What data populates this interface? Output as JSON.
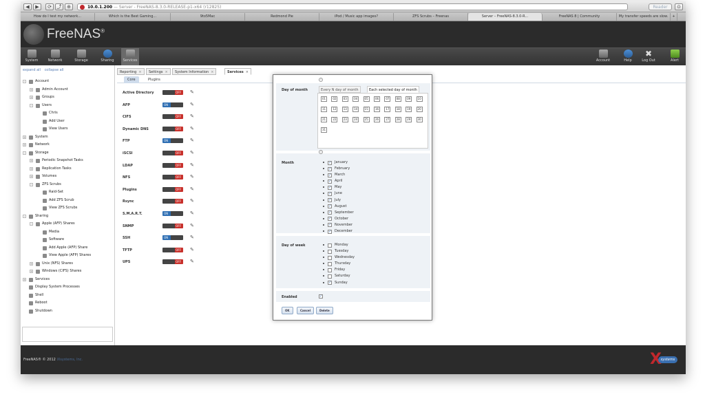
{
  "browser": {
    "nav_buttons": [
      "◀",
      "▶",
      "⟳",
      "⤴",
      "⊕"
    ],
    "address_host": "10.0.1.200",
    "address_rest": "— Server - FreeNAS-8.3.0-RELEASE-p1-x64 (r12825)",
    "reader_label": "Reader",
    "tabs": [
      "How do I test my network...",
      "Which is the Best Gaming...",
      "9to5Mac",
      "Redmond Pie",
      "iPod / Music app images?",
      "ZFS Scrubs – Freenas",
      "Server – FreeNAS-8.3.0-R...",
      "FreeNAS 8 | Community",
      "My transfer speeds are slow.",
      "+"
    ]
  },
  "header": {
    "logo_text": "FreeNAS",
    "logo_mark": "®"
  },
  "nav": {
    "left": [
      {
        "label": "System",
        "icon": "system-icon"
      },
      {
        "label": "Network",
        "icon": "network-icon"
      },
      {
        "label": "Storage",
        "icon": "storage-icon"
      },
      {
        "label": "Sharing",
        "icon": "sharing-icon"
      },
      {
        "label": "Services",
        "icon": "services-icon"
      }
    ],
    "right": [
      {
        "label": "Account",
        "icon": "account-icon"
      },
      {
        "label": "Help",
        "icon": "help-icon"
      },
      {
        "label": "Log Out",
        "icon": "logout-icon"
      },
      {
        "label": "Alert",
        "icon": "alert-icon"
      }
    ]
  },
  "tree": {
    "expand_all": "expand all",
    "collapse_all": "collapse all",
    "items": [
      {
        "label": "Account",
        "level": 0,
        "exp": "-"
      },
      {
        "label": "Admin Account",
        "level": 1,
        "exp": "+"
      },
      {
        "label": "Groups",
        "level": 1,
        "exp": "+"
      },
      {
        "label": "Users",
        "level": 1,
        "exp": "-"
      },
      {
        "label": "Chris",
        "level": 2,
        "exp": ""
      },
      {
        "label": "Add User",
        "level": 2,
        "exp": ""
      },
      {
        "label": "View Users",
        "level": 2,
        "exp": ""
      },
      {
        "label": "System",
        "level": 0,
        "exp": "+"
      },
      {
        "label": "Network",
        "level": 0,
        "exp": "+"
      },
      {
        "label": "Storage",
        "level": 0,
        "exp": "-"
      },
      {
        "label": "Periodic Snapshot Tasks",
        "level": 1,
        "exp": "+"
      },
      {
        "label": "Replication Tasks",
        "level": 1,
        "exp": "+"
      },
      {
        "label": "Volumes",
        "level": 1,
        "exp": "+"
      },
      {
        "label": "ZFS Scrubs",
        "level": 1,
        "exp": "-"
      },
      {
        "label": "Raid-Set",
        "level": 2,
        "exp": ""
      },
      {
        "label": "Add ZFS Scrub",
        "level": 2,
        "exp": ""
      },
      {
        "label": "View ZFS Scrubs",
        "level": 2,
        "exp": ""
      },
      {
        "label": "Sharing",
        "level": 0,
        "exp": "-"
      },
      {
        "label": "Apple (AFP) Shares",
        "level": 1,
        "exp": "-"
      },
      {
        "label": "Media",
        "level": 2,
        "exp": ""
      },
      {
        "label": "Software",
        "level": 2,
        "exp": ""
      },
      {
        "label": "Add Apple (AFP) Share",
        "level": 2,
        "exp": ""
      },
      {
        "label": "View Apple (AFP) Shares",
        "level": 2,
        "exp": ""
      },
      {
        "label": "Unix (NFS) Shares",
        "level": 1,
        "exp": "+"
      },
      {
        "label": "Windows (CIFS) Shares",
        "level": 1,
        "exp": "+"
      },
      {
        "label": "Services",
        "level": 0,
        "exp": "+"
      },
      {
        "label": "Display System Processes",
        "level": 0,
        "exp": ""
      },
      {
        "label": "Shell",
        "level": 0,
        "exp": ""
      },
      {
        "label": "Reboot",
        "level": 0,
        "exp": ""
      },
      {
        "label": "Shutdown",
        "level": 0,
        "exp": ""
      }
    ]
  },
  "content": {
    "tabs": [
      "Reporting",
      "Settings",
      "System Information",
      "Services"
    ],
    "tab_close": "×",
    "subtabs": [
      "Core",
      "Plugins"
    ],
    "services": [
      {
        "name": "Active Directory",
        "state": "OFF"
      },
      {
        "name": "AFP",
        "state": "ON"
      },
      {
        "name": "CIFS",
        "state": "OFF"
      },
      {
        "name": "Dynamic DNS",
        "state": "OFF"
      },
      {
        "name": "FTP",
        "state": "ON"
      },
      {
        "name": "iSCSI",
        "state": "OFF"
      },
      {
        "name": "LDAP",
        "state": "OFF"
      },
      {
        "name": "NFS",
        "state": "OFF"
      },
      {
        "name": "Plugins",
        "state": "OFF"
      },
      {
        "name": "Rsync",
        "state": "OFF"
      },
      {
        "name": "S.M.A.R.T.",
        "state": "ON"
      },
      {
        "name": "SNMP",
        "state": "OFF"
      },
      {
        "name": "SSH",
        "state": "ON"
      },
      {
        "name": "TFTP",
        "state": "OFF"
      },
      {
        "name": "UPS",
        "state": "OFF"
      }
    ]
  },
  "dialog": {
    "day_of_month_label": "Day of month",
    "dom_tabs": [
      "Every N day of month",
      "Each selected day of month"
    ],
    "days": [
      "01",
      "02",
      "03",
      "04",
      "05",
      "06",
      "07",
      "08",
      "09",
      "10",
      "11",
      "12",
      "13",
      "14",
      "15",
      "16",
      "17",
      "18",
      "19",
      "20",
      "21",
      "22",
      "23",
      "24",
      "25",
      "26",
      "27",
      "28",
      "29",
      "30",
      "31"
    ],
    "month_label": "Month",
    "months": [
      {
        "label": "January",
        "checked": true
      },
      {
        "label": "February",
        "checked": true
      },
      {
        "label": "March",
        "checked": true
      },
      {
        "label": "April",
        "checked": true
      },
      {
        "label": "May",
        "checked": true
      },
      {
        "label": "June",
        "checked": true
      },
      {
        "label": "July",
        "checked": true
      },
      {
        "label": "August",
        "checked": true
      },
      {
        "label": "September",
        "checked": true
      },
      {
        "label": "October",
        "checked": true
      },
      {
        "label": "November",
        "checked": true
      },
      {
        "label": "December",
        "checked": true
      }
    ],
    "day_of_week_label": "Day of week",
    "weekdays": [
      {
        "label": "Monday",
        "checked": false
      },
      {
        "label": "Tuesday",
        "checked": false
      },
      {
        "label": "Wednesday",
        "checked": false
      },
      {
        "label": "Thursday",
        "checked": false
      },
      {
        "label": "Friday",
        "checked": false
      },
      {
        "label": "Saturday",
        "checked": false
      },
      {
        "label": "Sunday",
        "checked": true
      }
    ],
    "enabled_label": "Enabled",
    "enabled_checked": true,
    "buttons": {
      "ok": "OK",
      "cancel": "Cancel",
      "delete": "Delete"
    }
  },
  "footer": {
    "copyright": "FreeNAS® © 2012",
    "company": "iXsystems, Inc.",
    "ix_mark": "X",
    "ix_label": "systems"
  },
  "colors": {
    "toggle_off": "#c8312c",
    "toggle_on": "#2f6fb3",
    "header_bg": "#2b2b2b",
    "accent_blue": "#3a6fb0"
  }
}
